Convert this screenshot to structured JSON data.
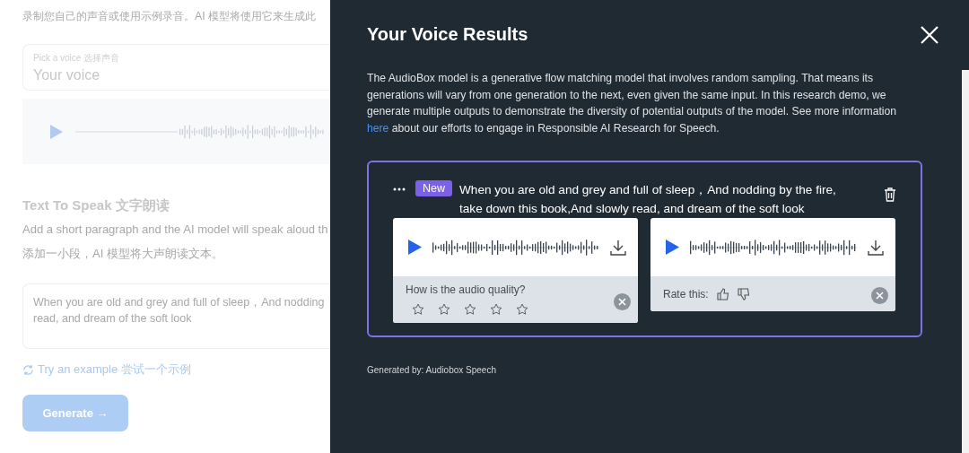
{
  "background_page": {
    "intro": "录制您自己的声音或使用示例录音。AI 模型将使用它来生成此",
    "voice_picker": {
      "label": "Pick a voice 选择声音",
      "value": "Your voice"
    },
    "section_title": "Text To Speak 文字朗读",
    "description_en": "Add a short paragraph and the AI model will speak aloud th",
    "description_zh": "添加一小段，AI 模型将大声朗读文本。",
    "text_input": {
      "placeholder_lines": [
        "When you are old and grey and full of sleep，And nodding",
        "read, and dream of the soft look"
      ]
    },
    "example_link": "Try an example 尝试一个示例",
    "generate_button": {
      "label": "Generate",
      "arrow": "→",
      "disabled": true
    }
  },
  "results_panel": {
    "title": "Your Voice Results",
    "description": {
      "before": "The AudioBox model is a generative flow matching model that involves random sampling. That means its generations will vary from one generation to the next, even given the same input. In this research demo, we generate multiple outputs to demonstrate the diversity of potential outputs of the model. See more information ",
      "link": "here",
      "after": " about our efforts to engage in Responsible AI Research for Speech."
    },
    "result": {
      "badge": "New",
      "text": "When you are old and grey and full of sleep，And nodding by the fire, take down this book,And slowly read, and dream of the soft look",
      "outputs": [
        {
          "kind": "stars",
          "prompt": "How is the audio quality?",
          "stars": 0
        },
        {
          "kind": "thumbs",
          "prompt": "Rate this:"
        }
      ]
    },
    "footer": "Generated by: Audiobox Speech"
  }
}
